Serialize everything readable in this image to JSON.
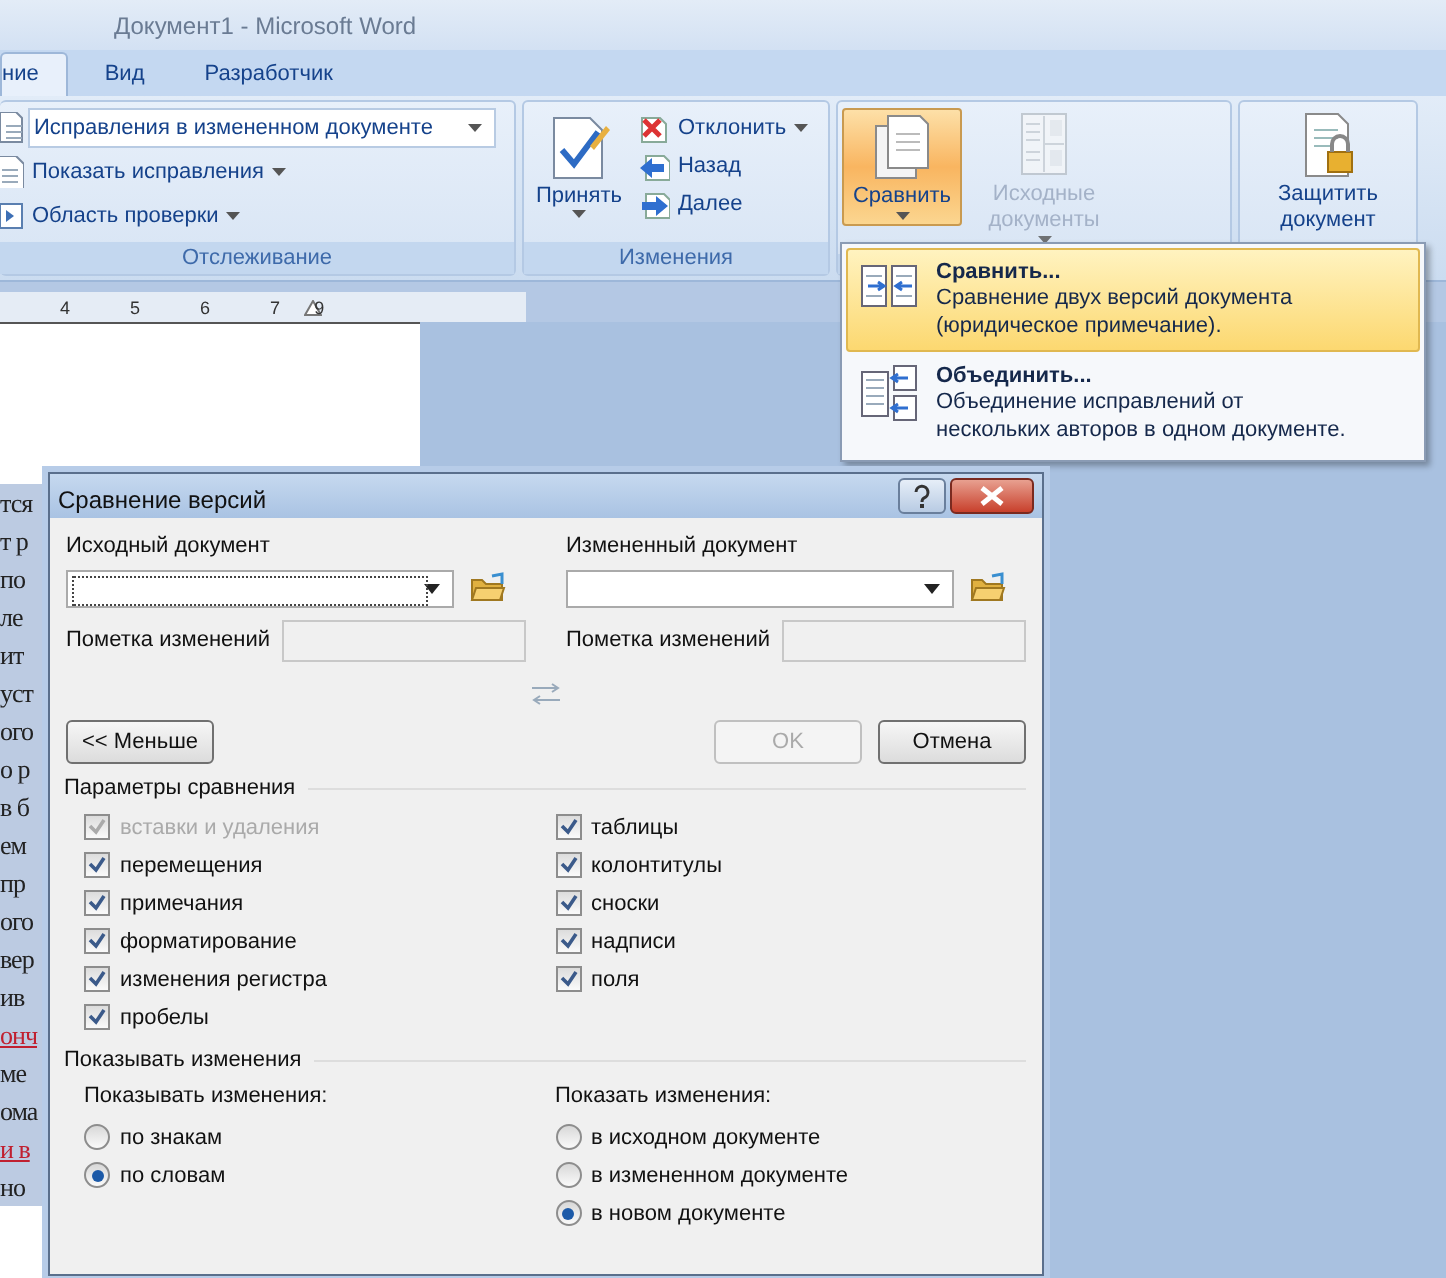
{
  "window": {
    "title": "Документ1 - Microsoft Word"
  },
  "tabs": [
    {
      "label": "ние",
      "selected": true
    },
    {
      "label": "Вид",
      "selected": false
    },
    {
      "label": "Разработчик",
      "selected": false
    }
  ],
  "tracking_group": {
    "label": "Отслеживание",
    "display_combo": "Исправления в измененном документе",
    "buttons": [
      "Показать исправления",
      "Область проверки"
    ]
  },
  "changes_group": {
    "label": "Изменения",
    "accept": "Принять",
    "buttons": [
      {
        "label": "Отклонить",
        "dropdown": true,
        "kind": "reject"
      },
      {
        "label": "Назад",
        "dropdown": false,
        "kind": "back"
      },
      {
        "label": "Далее",
        "dropdown": false,
        "kind": "next"
      }
    ]
  },
  "compare_group": {
    "buttons": [
      {
        "label": "Сравнить",
        "pressed": true,
        "disabled": false,
        "kind": "compare"
      },
      {
        "label": "Исходные документы",
        "pressed": false,
        "disabled": true,
        "kind": "sources"
      }
    ]
  },
  "protect_group": {
    "button": "Защитить документ"
  },
  "ruler": {
    "numbers": [
      "4",
      "5",
      "6",
      "7",
      "9"
    ]
  },
  "document": {
    "lines": [
      {
        "text": "тся",
        "revision": false
      },
      {
        "text": "т р",
        "revision": false
      },
      {
        "text": "по",
        "revision": false
      },
      {
        "text": "ле",
        "revision": false
      },
      {
        "text": "ит",
        "revision": false
      },
      {
        "text": "уст",
        "revision": false
      },
      {
        "text": "ого",
        "revision": false
      },
      {
        "text": "о р",
        "revision": false
      },
      {
        "text": "в б",
        "revision": false
      },
      {
        "text": "ем",
        "revision": false
      },
      {
        "text": "пр",
        "revision": false
      },
      {
        "text": "ого",
        "revision": false
      },
      {
        "text": "вер",
        "revision": false
      },
      {
        "text": "ив",
        "revision": false
      },
      {
        "text": "онч",
        "revision": true
      },
      {
        "text": "ме",
        "revision": false
      },
      {
        "text": "ома",
        "revision": false
      },
      {
        "text": "и в",
        "revision": true
      },
      {
        "text": "но",
        "revision": false
      }
    ]
  },
  "compare_menu": {
    "items": [
      {
        "title": "Сравнить...",
        "description": [
          "Сравнение двух версий документа",
          "(юридическое примечание)."
        ],
        "selected": true,
        "kind": "compare"
      },
      {
        "title": "Объединить...",
        "description": [
          "Объединение исправлений от",
          "нескольких авторов в одном документе."
        ],
        "selected": false,
        "kind": "merge"
      }
    ]
  },
  "dialog": {
    "title": "Сравнение версий",
    "documents": [
      {
        "label": "Исходный документ",
        "mark_label": "Пометка изменений",
        "focused": true
      },
      {
        "label": "Измененный документ",
        "mark_label": "Пометка изменений",
        "focused": false
      }
    ],
    "buttons": [
      {
        "label": "<< Меньше",
        "disabled": false
      },
      {
        "label": "OK",
        "disabled": true
      },
      {
        "label": "Отмена",
        "disabled": false
      }
    ],
    "settings": {
      "title": "Параметры сравнения",
      "columns": [
        [
          {
            "label": "вставки и удаления",
            "checked": true,
            "disabled": true
          },
          {
            "label": "перемещения",
            "checked": true,
            "disabled": false
          },
          {
            "label": "примечания",
            "checked": true,
            "disabled": false
          },
          {
            "label": "форматирование",
            "checked": true,
            "disabled": false
          },
          {
            "label": "изменения регистра",
            "checked": true,
            "disabled": false
          },
          {
            "label": "пробелы",
            "checked": true,
            "disabled": false
          }
        ],
        [
          {
            "label": "таблицы",
            "checked": true,
            "disabled": false
          },
          {
            "label": "колонтитулы",
            "checked": true,
            "disabled": false
          },
          {
            "label": "сноски",
            "checked": true,
            "disabled": false
          },
          {
            "label": "надписи",
            "checked": true,
            "disabled": false
          },
          {
            "label": "поля",
            "checked": true,
            "disabled": false
          }
        ]
      ]
    },
    "show_changes": {
      "title": "Показывать изменения",
      "groups": [
        {
          "title": "Показывать изменения:",
          "options": [
            {
              "label": "по знакам",
              "selected": false
            },
            {
              "label": "по словам",
              "selected": true
            }
          ]
        },
        {
          "title": "Показать изменения:",
          "options": [
            {
              "label": "в исходном документе",
              "selected": false
            },
            {
              "label": "в измененном документе",
              "selected": false
            },
            {
              "label": "в новом документе",
              "selected": true
            }
          ]
        }
      ]
    }
  }
}
